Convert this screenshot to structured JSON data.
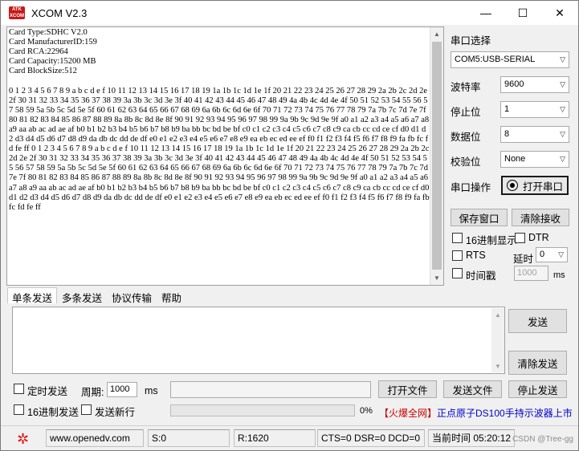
{
  "window": {
    "title": "XCOM V2.3",
    "logo_text": "ATK XCOM",
    "minimize": "—",
    "maximize": "☐",
    "close": "✕"
  },
  "receive": {
    "text": "Card Type:SDHC V2.0\nCard ManufacturerID:159\nCard RCA:22964\nCard Capacity:15200 MB\nCard BlockSize:512\n\n0 1 2 3 4 5 6 7 8 9 a b c d e f 10 11 12 13 14 15 16 17 18 19 1a 1b 1c 1d 1e 1f 20 21 22 23 24 25 26 27 28 29 2a 2b 2c 2d 2e 2f 30 31 32 33 34 35 36 37 38 39 3a 3b 3c 3d 3e 3f 40 41 42 43 44 45 46 47 48 49 4a 4b 4c 4d 4e 4f 50 51 52 53 54 55 56 57 58 59 5a 5b 5c 5d 5e 5f 60 61 62 63 64 65 66 67 68 69 6a 6b 6c 6d 6e 6f 70 71 72 73 74 75 76 77 78 79 7a 7b 7c 7d 7e 7f 80 81 82 83 84 85 86 87 88 89 8a 8b 8c 8d 8e 8f 90 91 92 93 94 95 96 97 98 99 9a 9b 9c 9d 9e 9f a0 a1 a2 a3 a4 a5 a6 a7 a8 a9 aa ab ac ad ae af b0 b1 b2 b3 b4 b5 b6 b7 b8 b9 ba bb bc bd be bf c0 c1 c2 c3 c4 c5 c6 c7 c8 c9 ca cb cc cd ce cf d0 d1 d2 d3 d4 d5 d6 d7 d8 d9 da db dc dd de df e0 e1 e2 e3 e4 e5 e6 e7 e8 e9 ea eb ec ed ee ef f0 f1 f2 f3 f4 f5 f6 f7 f8 f9 fa fb fc fd fe ff 0 1 2 3 4 5 6 7 8 9 a b c d e f 10 11 12 13 14 15 16 17 18 19 1a 1b 1c 1d 1e 1f 20 21 22 23 24 25 26 27 28 29 2a 2b 2c 2d 2e 2f 30 31 32 33 34 35 36 37 38 39 3a 3b 3c 3d 3e 3f 40 41 42 43 44 45 46 47 48 49 4a 4b 4c 4d 4e 4f 50 51 52 53 54 55 56 57 58 59 5a 5b 5c 5d 5e 5f 60 61 62 63 64 65 66 67 68 69 6a 6b 6c 6d 6e 6f 70 71 72 73 74 75 76 77 78 79 7a 7b 7c 7d 7e 7f 80 81 82 83 84 85 86 87 88 89 8a 8b 8c 8d 8e 8f 90 91 92 93 94 95 96 97 98 99 9a 9b 9c 9d 9e 9f a0 a1 a2 a3 a4 a5 a6 a7 a8 a9 aa ab ac ad ae af b0 b1 b2 b3 b4 b5 b6 b7 b8 b9 ba bb bc bd be bf c0 c1 c2 c3 c4 c5 c6 c7 c8 c9 ca cb cc cd ce cf d0 d1 d2 d3 d4 d5 d6 d7 d8 d9 da db dc dd de df e0 e1 e2 e3 e4 e5 e6 e7 e8 e9 ea eb ec ed ee ef f0 f1 f2 f3 f4 f5 f6 f7 f8 f9 fa fb fc fd fe ff"
  },
  "port_panel": {
    "port_select_label": "串口选择",
    "port_value": "COM5:USB-SERIAL",
    "baud_label": "波特率",
    "baud_value": "9600",
    "stop_label": "停止位",
    "stop_value": "1",
    "data_label": "数据位",
    "data_value": "8",
    "parity_label": "校验位",
    "parity_value": "None",
    "op_label": "串口操作",
    "open_button": "打开串口",
    "save_window": "保存窗口",
    "clear_receive": "清除接收",
    "hex_display": "16进制显示",
    "dtr": "DTR",
    "rts": "RTS",
    "delay_label": "延时",
    "delay_value": "0",
    "timestamp": "时间戳",
    "ts_value": "1000",
    "ts_unit": "ms"
  },
  "tabs": [
    "单条发送",
    "多条发送",
    "协议传输",
    "帮助"
  ],
  "send_panel": {
    "send_button": "发送",
    "clear_send": "清除发送",
    "timed_send": "定时发送",
    "period_label": "周期:",
    "period_value": "1000",
    "period_unit": "ms",
    "hex_send": "16进制发送",
    "send_newline": "发送新行",
    "open_file": "打开文件",
    "send_file": "发送文件",
    "stop_send": "停止发送",
    "progress_percent": 0,
    "progress_text": "0%",
    "ad_text_1": "【火爆全网】",
    "ad_text_2": "正点原子DS100手持示波器上市"
  },
  "statusbar": {
    "url": "www.openedv.com",
    "sent": "S:0",
    "received": "R:1620",
    "lines": "CTS=0 DSR=0 DCD=0",
    "time": "当前时间 05:20:12",
    "watermark": "CSDN @Tree-gg"
  }
}
